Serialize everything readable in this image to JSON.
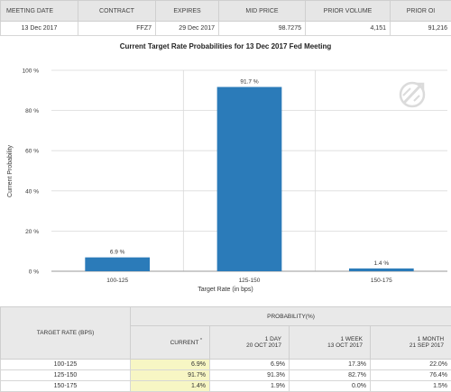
{
  "summary": {
    "headers": [
      "MEETING DATE",
      "CONTRACT",
      "EXPIRES",
      "MID PRICE",
      "PRIOR VOLUME",
      "PRIOR OI"
    ],
    "row": [
      "13 Dec 2017",
      "FFZ7",
      "29 Dec 2017",
      "98.7275",
      "4,151",
      "91,216"
    ]
  },
  "chart_data": {
    "type": "bar",
    "title": "Current Target Rate Probabilities for 13 Dec 2017 Fed Meeting",
    "xlabel": "Target Rate (in bps)",
    "ylabel": "Current Probability",
    "categories": [
      "100-125",
      "125-150",
      "150-175"
    ],
    "values": [
      6.9,
      91.7,
      1.4
    ],
    "value_labels": [
      "6.9 %",
      "91.7 %",
      "1.4 %"
    ],
    "ylim": [
      0,
      100
    ],
    "yticks": [
      0,
      20,
      40,
      60,
      80,
      100
    ],
    "ytick_labels": [
      "0 %",
      "20 %",
      "40 %",
      "60 %",
      "80 %",
      "100 %"
    ],
    "bar_color": "#2b7bb9",
    "grid": true
  },
  "probability_table": {
    "rate_header": "TARGET RATE (BPS)",
    "group_header": "PROBABILITY(%)",
    "current_header": "CURRENT",
    "current_mark": "*",
    "columns": [
      {
        "line1": "1 DAY",
        "line2": "20 OCT 2017"
      },
      {
        "line1": "1 WEEK",
        "line2": "13 OCT 2017"
      },
      {
        "line1": "1 MONTH",
        "line2": "21 SEP 2017"
      }
    ],
    "rows": [
      {
        "rate": "100-125",
        "current": "6.9%",
        "day": "6.9%",
        "week": "17.3%",
        "month": "22.0%"
      },
      {
        "rate": "125-150",
        "current": "91.7%",
        "day": "91.3%",
        "week": "82.7%",
        "month": "76.4%"
      },
      {
        "rate": "150-175",
        "current": "1.4%",
        "day": "1.9%",
        "week": "0.0%",
        "month": "1.5%"
      }
    ]
  }
}
